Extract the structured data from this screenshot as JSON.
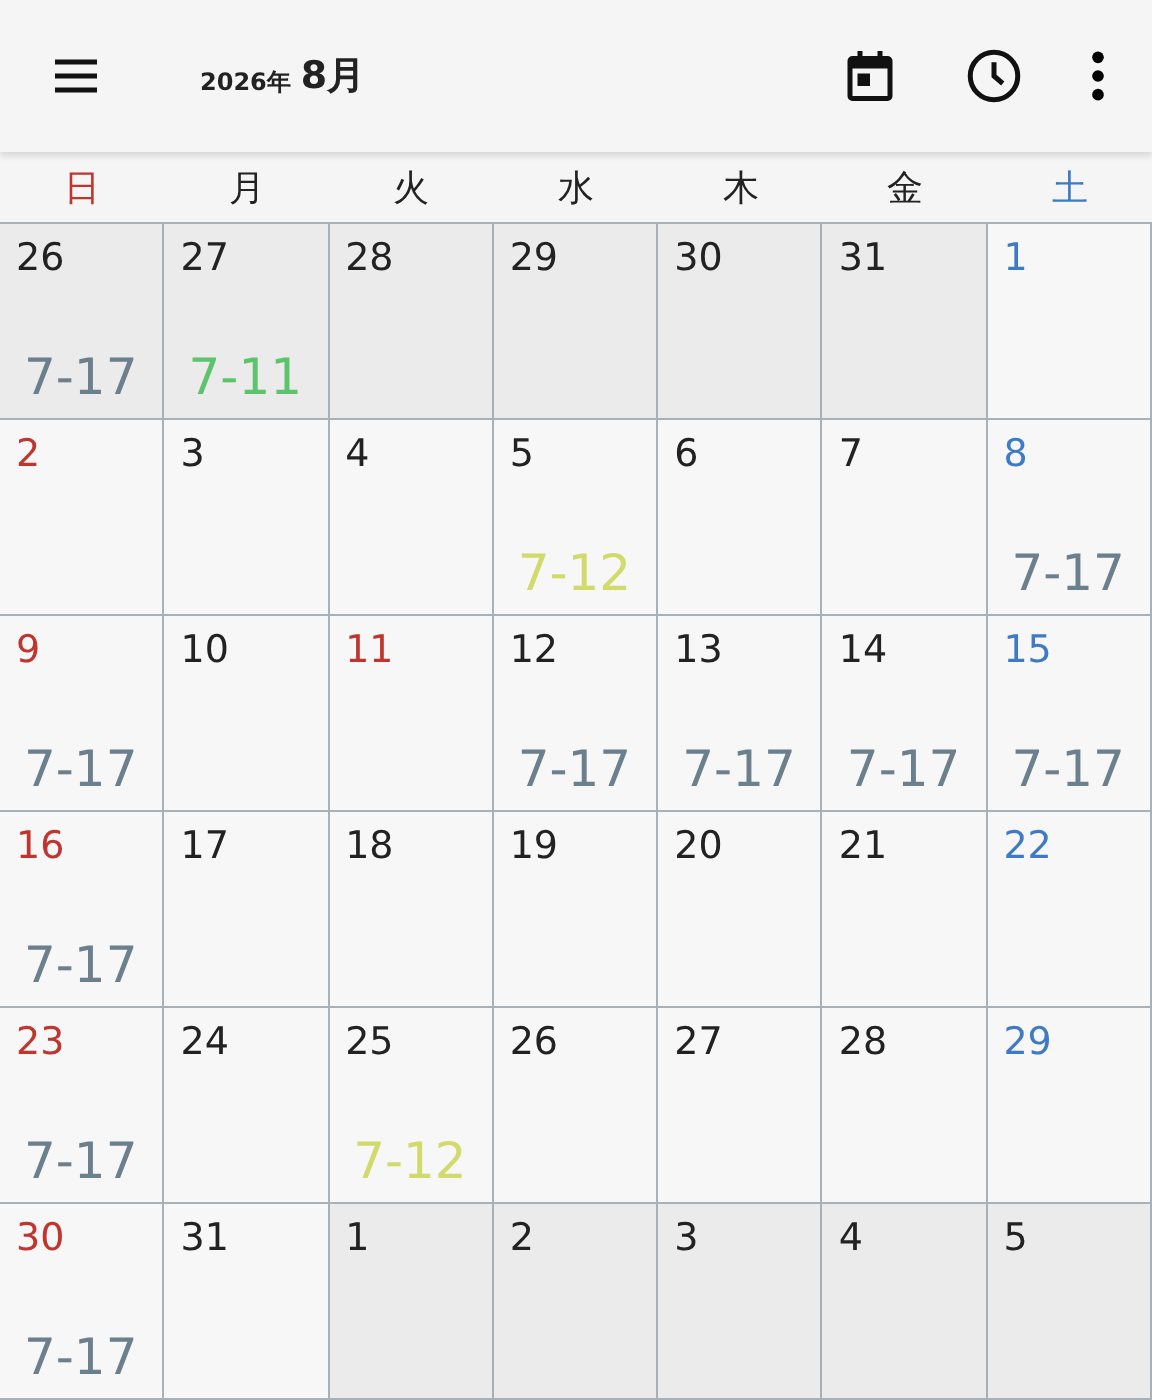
{
  "header": {
    "year": "2026年",
    "month": "8月"
  },
  "weekdays": [
    {
      "label": "日",
      "kind": "sun"
    },
    {
      "label": "月",
      "kind": "weekday"
    },
    {
      "label": "火",
      "kind": "weekday"
    },
    {
      "label": "水",
      "kind": "weekday"
    },
    {
      "label": "木",
      "kind": "weekday"
    },
    {
      "label": "金",
      "kind": "weekday"
    },
    {
      "label": "土",
      "kind": "sat"
    }
  ],
  "weeks": [
    [
      {
        "date": "26",
        "kind": "weekday",
        "in_month": false,
        "event": {
          "text": "7-17",
          "color": "#6b7f8d"
        }
      },
      {
        "date": "27",
        "kind": "weekday",
        "in_month": false,
        "event": {
          "text": "7-11",
          "color": "#5cc46c"
        }
      },
      {
        "date": "28",
        "kind": "weekday",
        "in_month": false
      },
      {
        "date": "29",
        "kind": "weekday",
        "in_month": false
      },
      {
        "date": "30",
        "kind": "weekday",
        "in_month": false
      },
      {
        "date": "31",
        "kind": "weekday",
        "in_month": false
      },
      {
        "date": "1",
        "kind": "sat",
        "in_month": true
      }
    ],
    [
      {
        "date": "2",
        "kind": "sun",
        "in_month": true
      },
      {
        "date": "3",
        "kind": "weekday",
        "in_month": true
      },
      {
        "date": "4",
        "kind": "weekday",
        "in_month": true
      },
      {
        "date": "5",
        "kind": "weekday",
        "in_month": true,
        "event": {
          "text": "7-12",
          "color": "#d2da6c"
        }
      },
      {
        "date": "6",
        "kind": "weekday",
        "in_month": true
      },
      {
        "date": "7",
        "kind": "weekday",
        "in_month": true
      },
      {
        "date": "8",
        "kind": "sat",
        "in_month": true,
        "event": {
          "text": "7-17",
          "color": "#6b7f8d"
        }
      }
    ],
    [
      {
        "date": "9",
        "kind": "sun",
        "in_month": true,
        "event": {
          "text": "7-17",
          "color": "#6b7f8d"
        }
      },
      {
        "date": "10",
        "kind": "weekday",
        "in_month": true
      },
      {
        "date": "11",
        "kind": "holiday",
        "in_month": true
      },
      {
        "date": "12",
        "kind": "weekday",
        "in_month": true,
        "event": {
          "text": "7-17",
          "color": "#6b7f8d"
        }
      },
      {
        "date": "13",
        "kind": "weekday",
        "in_month": true,
        "event": {
          "text": "7-17",
          "color": "#6b7f8d"
        }
      },
      {
        "date": "14",
        "kind": "weekday",
        "in_month": true,
        "event": {
          "text": "7-17",
          "color": "#6b7f8d"
        }
      },
      {
        "date": "15",
        "kind": "sat",
        "in_month": true,
        "event": {
          "text": "7-17",
          "color": "#6b7f8d"
        }
      }
    ],
    [
      {
        "date": "16",
        "kind": "sun",
        "in_month": true,
        "event": {
          "text": "7-17",
          "color": "#6b7f8d"
        }
      },
      {
        "date": "17",
        "kind": "weekday",
        "in_month": true
      },
      {
        "date": "18",
        "kind": "weekday",
        "in_month": true
      },
      {
        "date": "19",
        "kind": "weekday",
        "in_month": true
      },
      {
        "date": "20",
        "kind": "weekday",
        "in_month": true
      },
      {
        "date": "21",
        "kind": "weekday",
        "in_month": true
      },
      {
        "date": "22",
        "kind": "sat",
        "in_month": true
      }
    ],
    [
      {
        "date": "23",
        "kind": "sun",
        "in_month": true,
        "event": {
          "text": "7-17",
          "color": "#6b7f8d"
        }
      },
      {
        "date": "24",
        "kind": "weekday",
        "in_month": true
      },
      {
        "date": "25",
        "kind": "weekday",
        "in_month": true,
        "event": {
          "text": "7-12",
          "color": "#d2da6c"
        }
      },
      {
        "date": "26",
        "kind": "weekday",
        "in_month": true
      },
      {
        "date": "27",
        "kind": "weekday",
        "in_month": true
      },
      {
        "date": "28",
        "kind": "weekday",
        "in_month": true
      },
      {
        "date": "29",
        "kind": "sat",
        "in_month": true
      }
    ],
    [
      {
        "date": "30",
        "kind": "sun",
        "in_month": true,
        "event": {
          "text": "7-17",
          "color": "#6b7f8d"
        }
      },
      {
        "date": "31",
        "kind": "weekday",
        "in_month": true
      },
      {
        "date": "1",
        "kind": "weekday",
        "in_month": false
      },
      {
        "date": "2",
        "kind": "weekday",
        "in_month": false
      },
      {
        "date": "3",
        "kind": "weekday",
        "in_month": false
      },
      {
        "date": "4",
        "kind": "weekday",
        "in_month": false
      },
      {
        "date": "5",
        "kind": "weekday",
        "in_month": false
      }
    ]
  ]
}
